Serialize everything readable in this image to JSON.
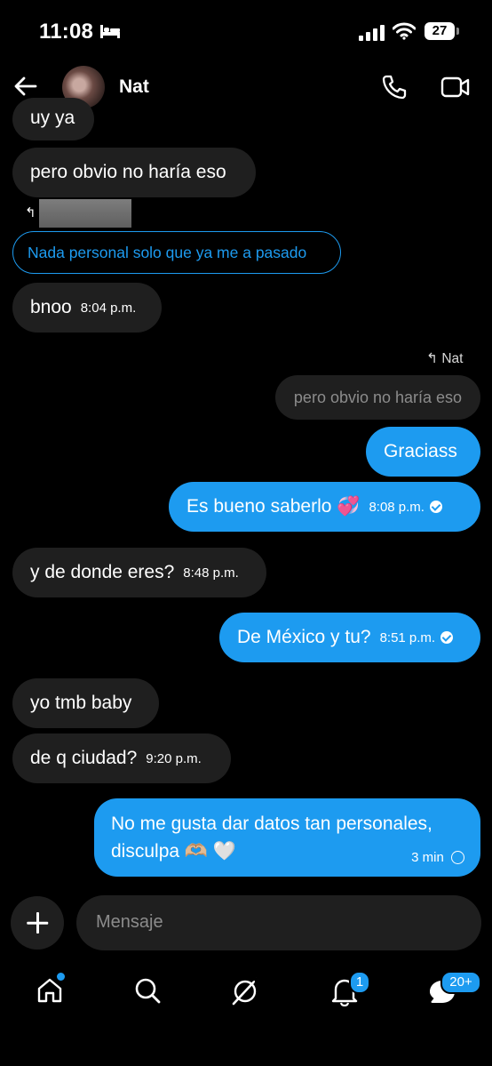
{
  "status_bar": {
    "time": "11:08",
    "battery": "27"
  },
  "header": {
    "contact_name": "Nat"
  },
  "messages": {
    "m1": {
      "text": "uy ya"
    },
    "m2": {
      "text": "pero obvio no haría eso"
    },
    "m3_reply_chip": {
      "text": "Nada personal solo que ya me a pasado"
    },
    "m4": {
      "text": "bnoo",
      "time": "8:04 p.m."
    },
    "reply_label": {
      "text": "Nat"
    },
    "quoted": {
      "text": "pero obvio no haría eso"
    },
    "m5": {
      "text": "Graciass"
    },
    "m6": {
      "text": "Es bueno saberlo 💞",
      "time": "8:08 p.m."
    },
    "m7": {
      "text": "y de donde eres?",
      "time": "8:48 p.m."
    },
    "m8": {
      "text": "De México y tu?",
      "time": "8:51 p.m."
    },
    "m9": {
      "text": "yo tmb baby"
    },
    "m10": {
      "text": "de q ciudad?",
      "time": "9:20 p.m."
    },
    "m11": {
      "line1": "No me gusta dar datos tan personales,",
      "line2": "disculpa 🫶🏼 🤍",
      "time": "3 min"
    }
  },
  "composer": {
    "placeholder": "Mensaje"
  },
  "nav": {
    "notifications_badge": "1",
    "messages_badge": "20+"
  },
  "colors": {
    "accent": "#1d9bf0",
    "incoming_bubble": "#1f1f1f",
    "background": "#000000"
  }
}
